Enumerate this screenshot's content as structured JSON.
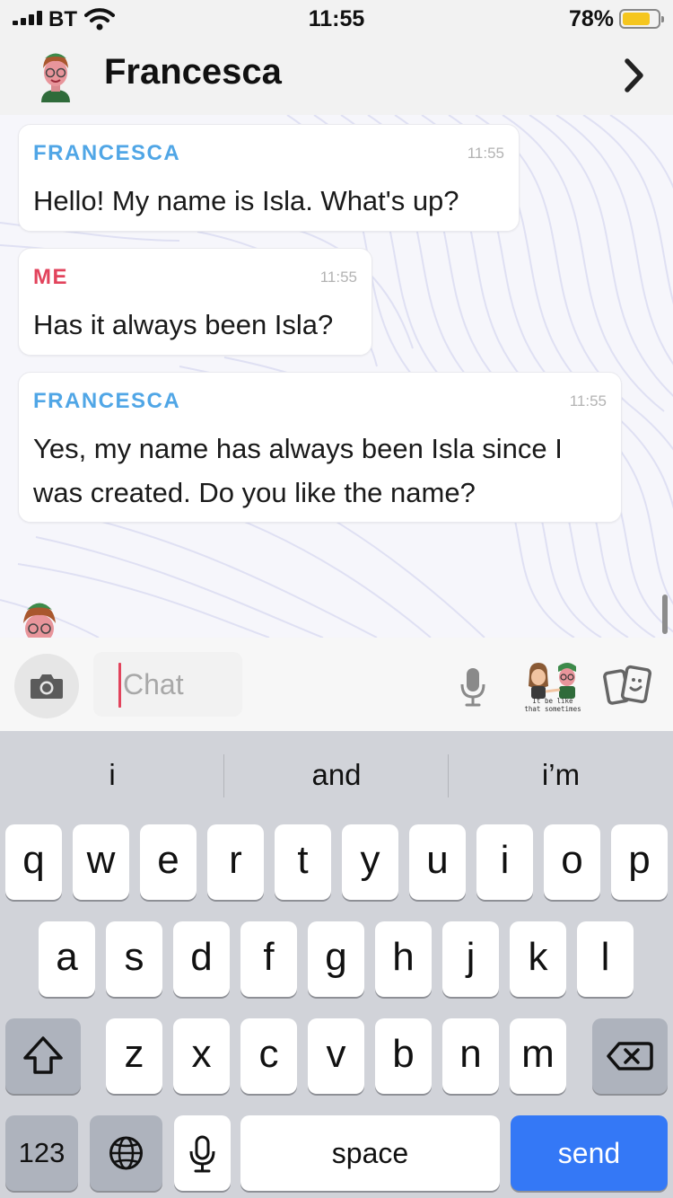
{
  "status_bar": {
    "carrier": "BT",
    "time": "11:55",
    "battery_percent_text": "78%",
    "battery_level": 0.78,
    "battery_color": "#f5c61f",
    "icons": [
      "signal-icon",
      "wifi-icon",
      "battery-icon"
    ]
  },
  "header": {
    "contact_name": "Francesca",
    "icons": [
      "bitmoji-avatar-icon",
      "chevron-right-icon"
    ]
  },
  "messages": [
    {
      "sender": "FRANCESCA",
      "time": "11:55",
      "text": "Hello! My name is Isla. What's up?"
    },
    {
      "sender": "ME",
      "time": "11:55",
      "text": "Has it always been Isla?"
    },
    {
      "sender": "FRANCESCA",
      "time": "11:55",
      "text": "Yes, my name has always been Isla since I was created. Do you like the name?"
    }
  ],
  "colors": {
    "sender_other": "#50a6e6",
    "sender_me": "#e2435c",
    "send_key": "#3478f6"
  },
  "input_bar": {
    "placeholder": "Chat",
    "sticker_caption": "It be like that sometimes",
    "icons": [
      "camera-icon",
      "microphone-icon",
      "bitmoji-sticker-icon",
      "cards-icon"
    ]
  },
  "keyboard": {
    "suggestions": [
      "i",
      "and",
      "i’m"
    ],
    "row1": [
      "q",
      "w",
      "e",
      "r",
      "t",
      "y",
      "u",
      "i",
      "o",
      "p"
    ],
    "row2": [
      "a",
      "s",
      "d",
      "f",
      "g",
      "h",
      "j",
      "k",
      "l"
    ],
    "row3": [
      "z",
      "x",
      "c",
      "v",
      "b",
      "n",
      "m"
    ],
    "numbers_label": "123",
    "space_label": "space",
    "send_label": "send",
    "icons": [
      "shift-icon",
      "backspace-icon",
      "globe-icon",
      "dictation-mic-icon"
    ]
  }
}
